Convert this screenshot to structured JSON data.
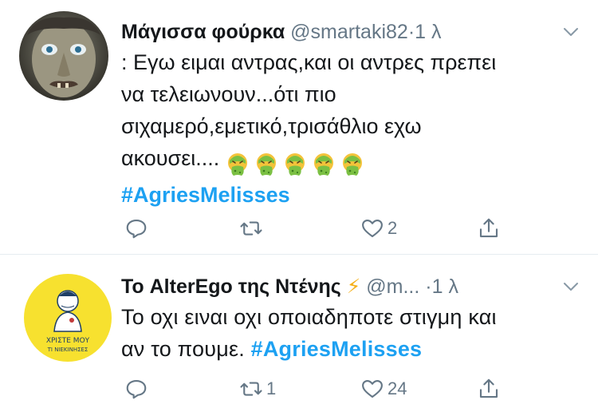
{
  "tweets": [
    {
      "display_name": "Μάγισσα φούρκα",
      "handle": "@smartaki82",
      "separator": "·",
      "time": "1 λ",
      "avatar": "witch-avatar",
      "text_lines": [
        ": Εγω ειμαι αντρας,και οι αντρες πρεπει",
        "να τελειωνουν...ότι πιο",
        "σιχαμερό,εμετικό,τρισάθλιο εχω",
        "ακουσει...."
      ],
      "emoji_count": 5,
      "emoji_icon": "vomiting-face-icon",
      "hashtag": "#AgriesMelisses",
      "reply_count": "",
      "retweet_count": "",
      "like_count": "2"
    },
    {
      "display_name": "Το AlterEgo της Ντένης",
      "name_emoji": "⚡",
      "handle": "@m...",
      "separator": "·",
      "time": "1 λ",
      "avatar": "illustrated-nurse-avatar",
      "avatar_text_line1": "ΧΡΙΣΤΕ ΜΟΥ",
      "avatar_text_line2": "ΤΙ ΝΙΕΚΙΝΗΣΕΣ",
      "text_line1": "Το οχι ειναι οχι οποιαδηποτε στιγμη και",
      "text_line2_prefix": "αν το πουμε.",
      "hashtag": "#AgriesMelisses",
      "reply_count": "",
      "retweet_count": "1",
      "like_count": "24"
    }
  ],
  "colors": {
    "text": "#14171a",
    "muted": "#657786",
    "accent": "#1da1f2",
    "divider": "#e6ecf0",
    "bolt": "#f5b01a",
    "emoji_face": "#7bc043"
  }
}
